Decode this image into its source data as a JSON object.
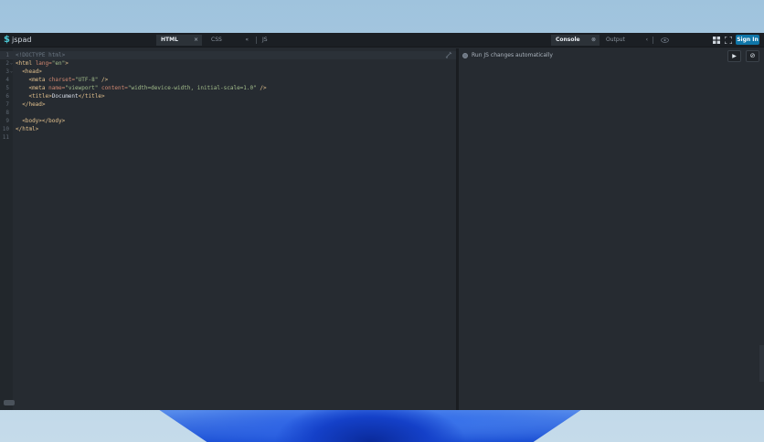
{
  "app": {
    "logo_mark": "$",
    "logo_text": "jspad"
  },
  "tabs": [
    {
      "label": "HTML",
      "close": "×"
    },
    {
      "label": "CSS",
      "close": "«"
    },
    {
      "label": "JS",
      "close": ""
    }
  ],
  "right_tabs": [
    {
      "label": "Console",
      "close": "⊗"
    },
    {
      "label": "Output",
      "close": "‹"
    }
  ],
  "actions": {
    "signin_label": "Sign In",
    "eye_icon": "eye-icon",
    "grid_icon": "grid-icon",
    "fullscreen_icon": "fullscreen-icon"
  },
  "editor": {
    "lines": [
      {
        "n": "1",
        "fold": "",
        "html": "<span class=\"c-doc\">&lt;!DOCTYPE html&gt;</span>"
      },
      {
        "n": "2",
        "fold": "⌄",
        "html": "<span class=\"c-tag\">&lt;html</span> <span class=\"c-attr\">lang=</span><span class=\"c-str\">\"en\"</span><span class=\"c-tag\">&gt;</span>"
      },
      {
        "n": "3",
        "fold": "⌄",
        "html": "  <span class=\"c-tag\">&lt;head&gt;</span>"
      },
      {
        "n": "4",
        "fold": "",
        "html": "    <span class=\"c-tag\">&lt;meta</span> <span class=\"c-attr\">charset=</span><span class=\"c-str\">\"UTF-8\"</span> <span class=\"c-tag\">/&gt;</span>"
      },
      {
        "n": "5",
        "fold": "",
        "html": "    <span class=\"c-tag\">&lt;meta</span> <span class=\"c-attr\">name=</span><span class=\"c-str\">\"viewport\"</span> <span class=\"c-attr\">content=</span><span class=\"c-str\">\"width=device-width, initial-scale=1.0\"</span> <span class=\"c-tag\">/&gt;</span>"
      },
      {
        "n": "6",
        "fold": "",
        "html": "    <span class=\"c-tag\">&lt;title&gt;</span><span class=\"c-txt\">Document</span><span class=\"c-tag\">&lt;/title&gt;</span>"
      },
      {
        "n": "7",
        "fold": "",
        "html": "  <span class=\"c-tag\">&lt;/head&gt;</span>"
      },
      {
        "n": "8",
        "fold": "",
        "html": ""
      },
      {
        "n": "9",
        "fold": "",
        "html": "  <span class=\"c-tag\">&lt;body&gt;&lt;/body&gt;</span>"
      },
      {
        "n": "10",
        "fold": "",
        "html": "<span class=\"c-tag\">&lt;/html&gt;</span>"
      },
      {
        "n": "11",
        "fold": "",
        "html": ""
      }
    ]
  },
  "console": {
    "autorun_label": "Run JS changes automatically",
    "run_icon": "▶",
    "clear_icon": "⊘"
  }
}
